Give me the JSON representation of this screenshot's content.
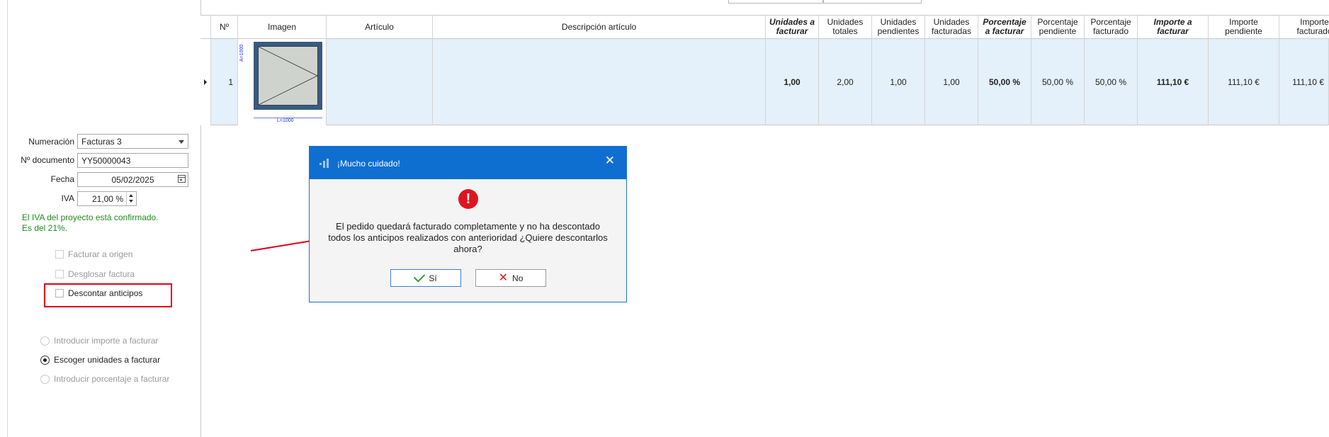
{
  "colors": {
    "accent": "#0f6fd1",
    "highlight_border": "#e0001b",
    "success_text": "#1e8c1e",
    "selected_row": "#e4f0fa",
    "error_icon": "#e0141e"
  },
  "form": {
    "numeracion_label": "Numeración",
    "numeracion_value": "Facturas 3",
    "documento_label": "Nº documento",
    "documento_value": "YY50000043",
    "fecha_label": "Fecha",
    "fecha_value": "05/02/2025",
    "iva_label": "IVA",
    "iva_value": "21,00 %",
    "iva_note_line1": "El IVA del proyecto está confirmado.",
    "iva_note_line2": "Es del 21%."
  },
  "checkboxes": [
    {
      "label": "Facturar a origen",
      "checked": false,
      "enabled": false
    },
    {
      "label": "Desglosar factura",
      "checked": false,
      "enabled": false
    },
    {
      "label": "Descontar anticipos",
      "checked": false,
      "enabled": true
    }
  ],
  "radios": [
    {
      "label": "Introducir importe a facturar",
      "selected": false,
      "enabled": false
    },
    {
      "label": "Escoger unidades a facturar",
      "selected": true,
      "enabled": true
    },
    {
      "label": "Introducir porcentaje a facturar",
      "selected": false,
      "enabled": false
    }
  ],
  "grid": {
    "headers": {
      "n": "Nº",
      "imagen": "Imagen",
      "articulo": "Artículo",
      "descripcion": "Descripción artículo",
      "unidades_facturar_1": "Unidades a",
      "unidades_facturar_2": "facturar",
      "unidades_totales_1": "Unidades",
      "unidades_totales_2": "totales",
      "unidades_pendientes_1": "Unidades",
      "unidades_pendientes_2": "pendientes",
      "unidades_facturadas_1": "Unidades",
      "unidades_facturadas_2": "facturadas",
      "porcentaje_facturar_1": "Porcentaje",
      "porcentaje_facturar_2": "a facturar",
      "porcentaje_pendiente_1": "Porcentaje",
      "porcentaje_pendiente_2": "pendiente",
      "porcentaje_facturado_1": "Porcentaje",
      "porcentaje_facturado_2": "facturado",
      "importe_facturar_1": "Importe a",
      "importe_facturar_2": "facturar",
      "importe_pendiente_1": "Importe",
      "importe_pendiente_2": "pendiente",
      "importe_facturado_1": "Importe",
      "importe_facturado_2": "facturado"
    },
    "row": {
      "n": "1",
      "articulo": "",
      "descripcion": "",
      "unidades_facturar": "1,00",
      "unidades_totales": "2,00",
      "unidades_pendientes": "1,00",
      "unidades_facturadas": "1,00",
      "porcentaje_facturar": "50,00 %",
      "porcentaje_pendiente": "50,00 %",
      "porcentaje_facturado": "50,00 %",
      "importe_facturar": "111,10 €",
      "importe_pendiente": "111,10 €",
      "importe_facturado": "111,10 €",
      "thumb_height": "A=1000",
      "thumb_width": "L=1000"
    }
  },
  "dialog": {
    "title": "¡Mucho cuidado!",
    "icon": "error-icon",
    "message": "El pedido quedará facturado completamente y no ha descontado todos los anticipos realizados con anterioridad ¿Quiere descontarlos ahora?",
    "yes_label": "Sí",
    "no_label": "No"
  }
}
